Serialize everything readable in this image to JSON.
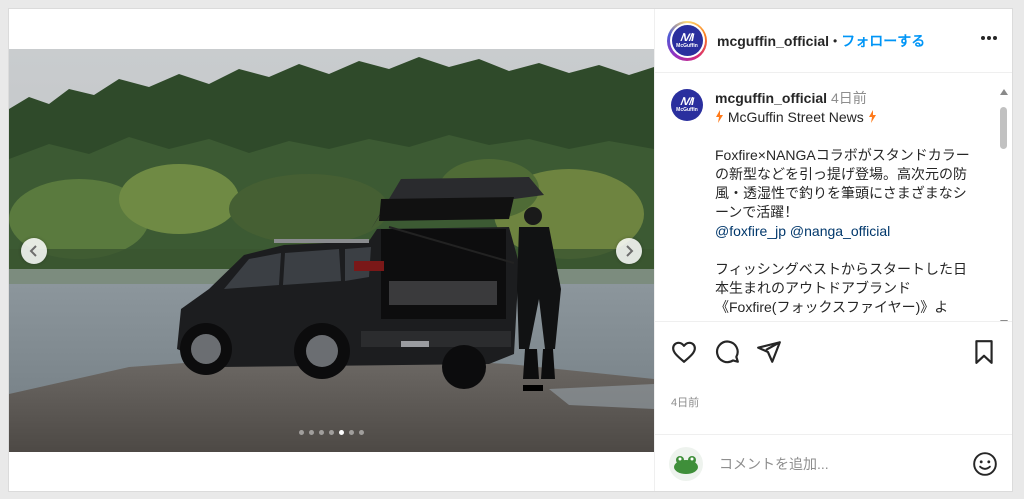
{
  "header": {
    "avatar_text": "McGuffin",
    "username": "mcguffin_official",
    "separator": "•",
    "follow_label": "フォローする"
  },
  "caption": {
    "username": "mcguffin_official",
    "time": "4日前",
    "title": "McGuffin Street News",
    "line1": "Foxfire×NANGAコラボがスタンドカラーの新型などを引っ提げ登場。高次元の防風・透湿性で釣りを筆頭にさまざまなシーンで活躍！",
    "mention1": "@foxfire_jp",
    "mention2": "@nanga_official",
    "line2": "フィッシングベストからスタートした日本生まれのアウトドアブランド《Foxfire(フォックスファイヤー)》よ"
  },
  "carousel": {
    "slide_count": 7,
    "active_index": 4
  },
  "post_time": "4日前",
  "comment": {
    "placeholder": "コメントを追加..."
  },
  "colors": {
    "link": "#0095f6",
    "mention": "#00376b",
    "avatar_bg": "#2a2f9e",
    "fire": "#ff7a1a"
  },
  "icons": [
    "chevron-left-icon",
    "chevron-right-icon",
    "more-icon",
    "heart-icon",
    "comment-icon",
    "share-icon",
    "bookmark-icon",
    "emoji-icon",
    "fire-icon"
  ]
}
